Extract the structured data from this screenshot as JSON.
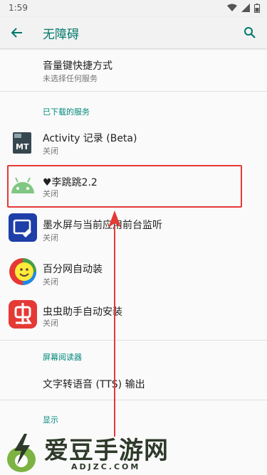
{
  "status_bar": {
    "time": "1:59",
    "icons": [
      "wifi-icon",
      "signal-icon",
      "battery-icon"
    ]
  },
  "app_bar": {
    "title": "无障碍",
    "back_icon": "arrow-left-icon",
    "search_icon": "search-icon",
    "accent_color": "#00796b"
  },
  "shortcut": {
    "title": "音量键快捷方式",
    "subtitle": "未选择任何服务"
  },
  "downloaded_services": {
    "header": "已下载的服务",
    "items": [
      {
        "title": "Activity 记录 (Beta)",
        "subtitle": "关闭",
        "icon": "mt-app-icon"
      },
      {
        "title": "♥李跳跳2.2",
        "subtitle": "关闭",
        "icon": "android-icon"
      },
      {
        "title": "墨水屏与当前应用前台监听",
        "subtitle": "关闭",
        "icon": "toolbox-app-icon"
      },
      {
        "title": "百分网自动装",
        "subtitle": "关闭",
        "icon": "smiley-app-icon"
      },
      {
        "title": "虫虫助手自动安装",
        "subtitle": "关闭",
        "icon": "chongchong-app-icon"
      }
    ]
  },
  "screen_reader": {
    "header": "屏幕阅读器",
    "items": [
      {
        "title": "文字转语音 (TTS) 输出"
      }
    ]
  },
  "display": {
    "header": "显示"
  },
  "watermark": {
    "text": "爱豆手游网",
    "url": "ADJZC.COM"
  },
  "colors": {
    "highlight": "#e53935",
    "header_text": "#00897b"
  }
}
